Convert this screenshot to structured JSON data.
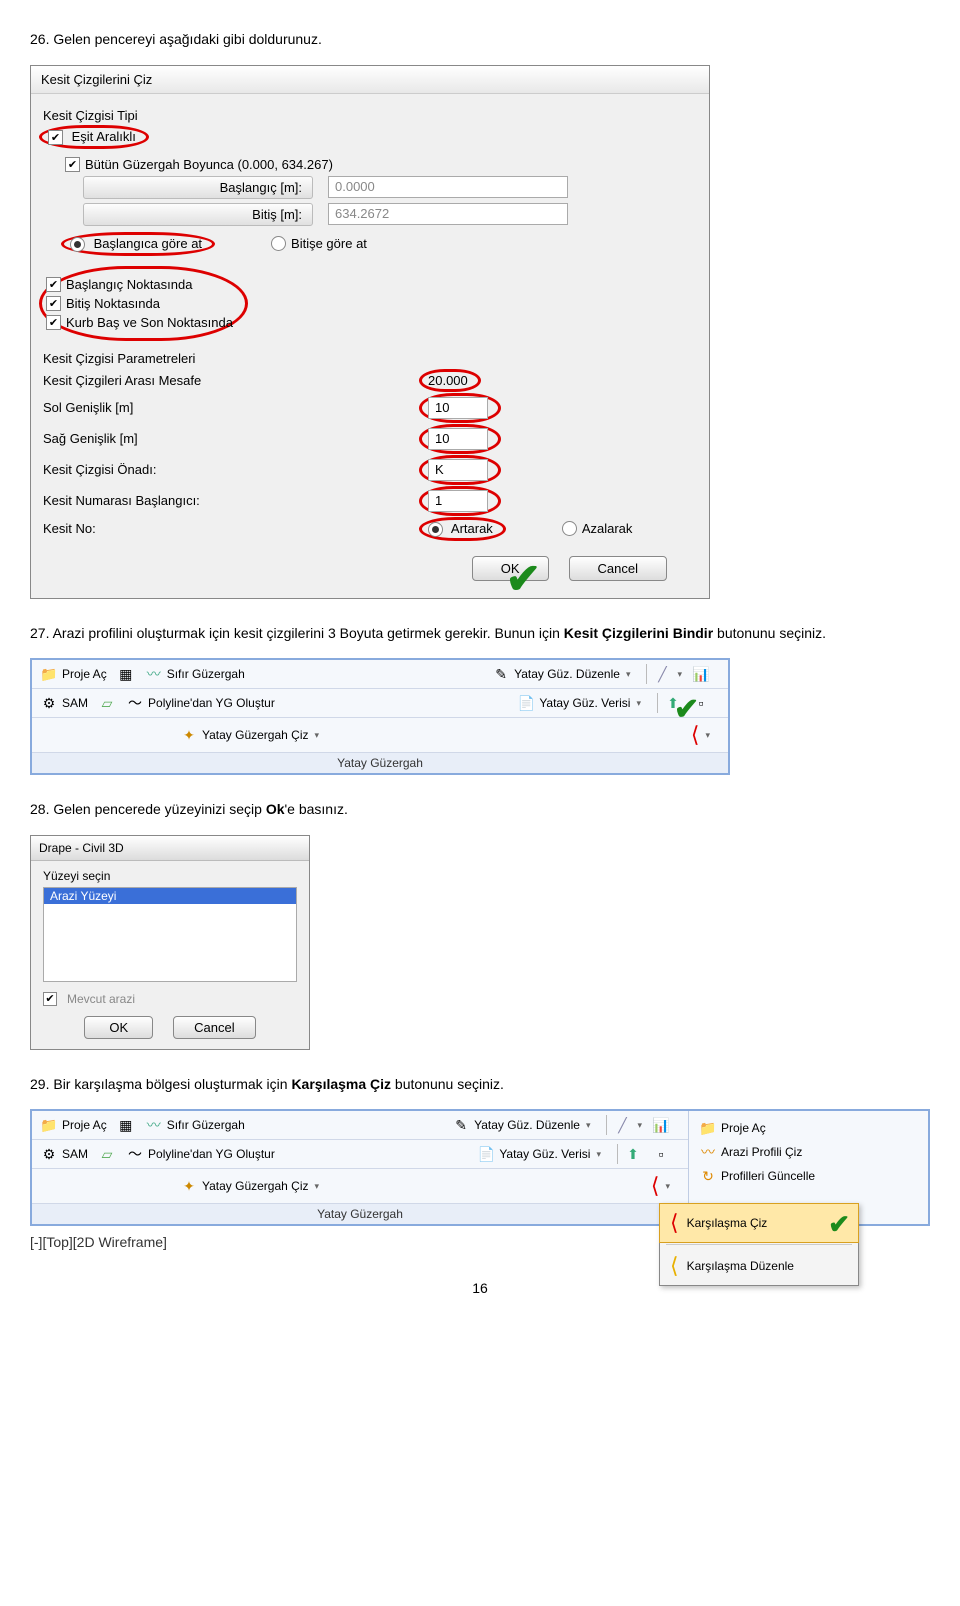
{
  "step26": {
    "text": "26. Gelen pencereyi aşağıdaki gibi doldurunuz."
  },
  "dialog1": {
    "title": "Kesit Çizgilerini Çiz",
    "type_label": "Kesit Çizgisi Tipi",
    "type_value": "Eşit Aralıklı",
    "full_route": "Bütün Güzergah Boyunca (0.000, 634.267)",
    "start_label": "Başlangıç [m]:",
    "start_value": "0.0000",
    "end_label": "Bitiş [m]:",
    "end_value": "634.2672",
    "radio_start": "Başlangıca göre at",
    "radio_end": "Bitişe göre at",
    "chk_start": "Başlangıç Noktasında",
    "chk_end": "Bitiş Noktasında",
    "chk_curve": "Kurb Baş ve Son Noktasında",
    "params_header": "Kesit Çizgisi Parametreleri",
    "p_distance_label": "Kesit Çizgileri Arası Mesafe",
    "p_distance": "20.000",
    "p_left_label": "Sol Genişlik [m]",
    "p_left": "10",
    "p_right_label": "Sağ Genişlik [m]",
    "p_right": "10",
    "p_prefix_label": "Kesit Çizgisi Önadı:",
    "p_prefix": "K",
    "p_startno_label": "Kesit Numarası Başlangıcı:",
    "p_startno": "1",
    "p_no_label": "Kesit No:",
    "p_no_inc": "Artarak",
    "p_no_dec": "Azalarak",
    "ok": "OK",
    "cancel": "Cancel"
  },
  "step27": {
    "text1": "27. Arazi profilini oluşturmak için kesit çizgilerini 3 Boyuta getirmek gerekir. Bunun için ",
    "bold": "Kesit Çizgilerini Bindir",
    "text2": " butonunu seçiniz."
  },
  "ribbon1": {
    "proje_ac": "Proje Aç",
    "sifir": "Sıfır Güzergah",
    "yatay_duzenle": "Yatay Güz. Düzenle",
    "sam": "SAM",
    "polyline": "Polyline'dan YG Oluştur",
    "yatay_verisi": "Yatay Güz. Verisi",
    "yatay_ciz": "Yatay Güzergah Çiz",
    "title": "Yatay Güzergah"
  },
  "step28": {
    "text1": "28. Gelen pencerede yüzeyinizi seçip ",
    "bold": "Ok",
    "text2": "'e basınız."
  },
  "drape": {
    "title": "Drape - Civil 3D",
    "label": "Yüzeyi seçin",
    "item": "Arazi Yüzeyi",
    "chk": "Mevcut arazi",
    "ok": "OK",
    "cancel": "Cancel"
  },
  "step29": {
    "text1": "29. Bir karşılaşma bölgesi oluşturmak için ",
    "bold": "Karşılaşma Çiz",
    "text2": " butonunu seçiniz."
  },
  "ribbon2": {
    "proje_ac": "Proje Aç",
    "sifir": "Sıfır Güzergah",
    "yatay_duzenle": "Yatay Güz. Düzenle",
    "sam": "SAM",
    "polyline": "Polyline'dan YG Oluştur",
    "yatay_verisi": "Yatay Güz. Verisi",
    "yatay_ciz": "Yatay Güzergah Çiz",
    "title": "Yatay Güzergah",
    "r_proje_ac": "Proje Aç",
    "r_arazi": "Arazi Profili Çiz",
    "r_guncelle": "Profilleri Güncelle",
    "ctx_karsilasma": "Karşılaşma Çiz",
    "ctx_duzenle": "Karşılaşma Düzenle",
    "viewport": "[-][Top][2D Wireframe]"
  },
  "page": "16"
}
